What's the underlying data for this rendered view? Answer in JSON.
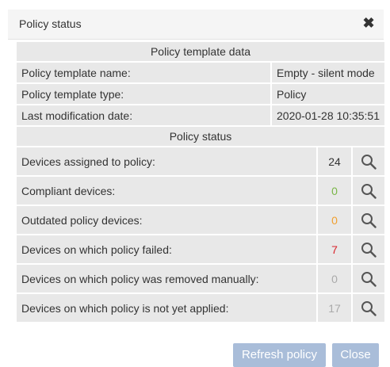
{
  "dialog": {
    "title": "Policy status",
    "close_glyph": "✖"
  },
  "template_section": {
    "header": "Policy template data",
    "rows": [
      {
        "label": "Policy template name:",
        "value": "Empty - silent mode"
      },
      {
        "label": "Policy template type:",
        "value": "Policy"
      },
      {
        "label": "Last modification date:",
        "value": "2020-01-28 10:35:51"
      }
    ]
  },
  "status_section": {
    "header": "Policy status",
    "rows": [
      {
        "label": "Devices assigned to policy:",
        "count": "24",
        "color": "#333333"
      },
      {
        "label": "Compliant devices:",
        "count": "0",
        "color": "#7ab648"
      },
      {
        "label": "Outdated policy devices:",
        "count": "0",
        "color": "#f0a030"
      },
      {
        "label": "Devices on which policy failed:",
        "count": "7",
        "color": "#d9252b"
      },
      {
        "label": "Devices on which policy was removed manually:",
        "count": "0",
        "color": "#aaaaaa"
      },
      {
        "label": "Devices on which policy is not yet applied:",
        "count": "17",
        "color": "#aaaaaa"
      }
    ],
    "action_icon": "magnifier-icon"
  },
  "buttons": {
    "refresh": "Refresh policy",
    "close": "Close"
  }
}
